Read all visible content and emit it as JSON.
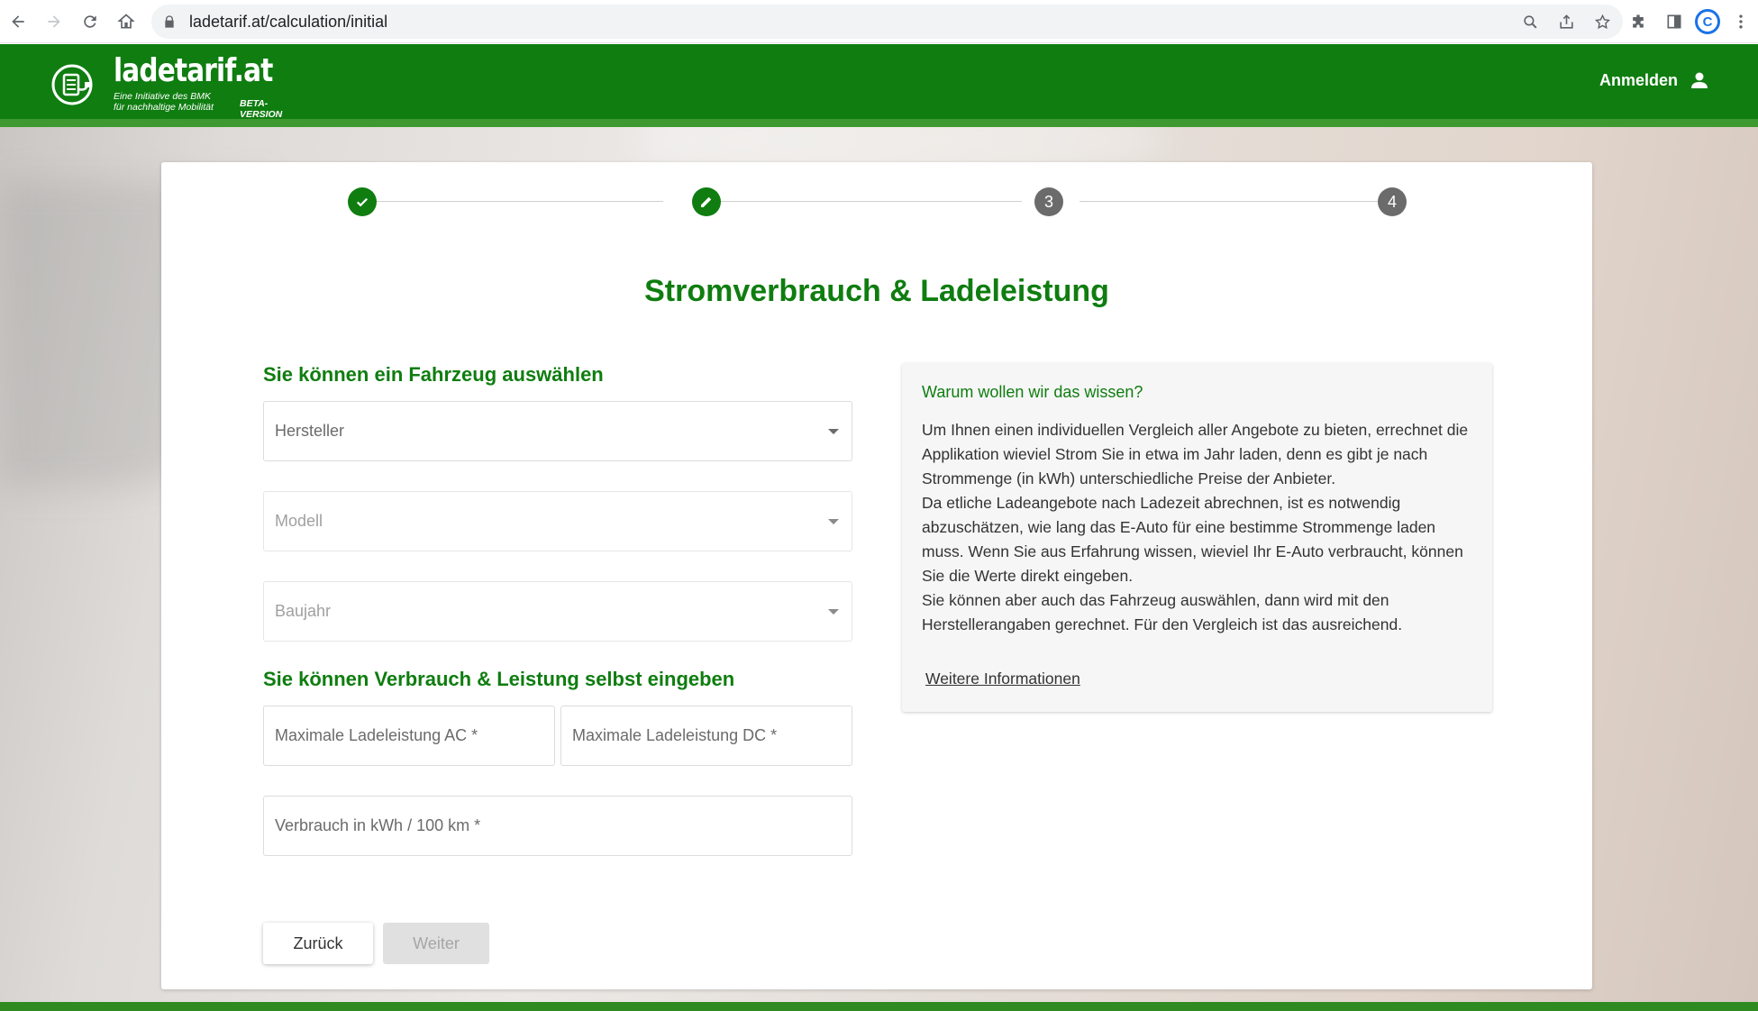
{
  "browser": {
    "url": "ladetarif.at/calculation/initial",
    "profile_initial": "C"
  },
  "header": {
    "logo_title": "ladetarif.at",
    "logo_sub_line1": "Eine Initiative des BMK",
    "logo_sub_line2": "für nachhaltige Mobilität",
    "beta_line1": "BETA-",
    "beta_line2": "VERSION",
    "login_label": "Anmelden"
  },
  "stepper": {
    "steps": [
      {
        "state": "done",
        "icon": "check-icon"
      },
      {
        "state": "active",
        "icon": "pencil-icon"
      },
      {
        "state": "todo",
        "label": "3"
      },
      {
        "state": "todo",
        "label": "4"
      }
    ]
  },
  "main": {
    "title": "Stromverbrauch & Ladeleistung",
    "vehicle_section_title": "Sie können ein Fahrzeug auswählen",
    "manufacturer_placeholder": "Hersteller",
    "model_placeholder": "Modell",
    "year_placeholder": "Baujahr",
    "manual_section_title": "Sie können Verbrauch & Leistung selbst eingeben",
    "ac_placeholder": "Maximale Ladeleistung AC *",
    "dc_placeholder": "Maximale Ladeleistung DC *",
    "consumption_placeholder": "Verbrauch in kWh / 100 km *",
    "back_label": "Zurück",
    "next_label": "Weiter"
  },
  "info": {
    "title": "Warum wollen wir das wissen?",
    "paragraph1": "Um Ihnen einen individuellen Vergleich aller Angebote zu bieten, errechnet die Applikation wieviel Strom Sie in etwa im Jahr laden, denn es gibt je nach Strommenge (in kWh) unterschiedliche Preise der Anbieter.",
    "paragraph2": "Da etliche Ladeangebote nach Ladezeit abrechnen, ist es notwendig abzuschätzen, wie lang das E-Auto für eine bestimme Strommenge laden muss. Wenn Sie aus Erfahrung wissen, wieviel Ihr E-Auto verbraucht, können Sie die Werte direkt eingeben.",
    "paragraph3": "Sie können aber auch das Fahrzeug auswählen, dann wird mit den Herstellerangaben gerechnet. Für den Vergleich ist das ausreichend.",
    "link_label": "Weitere Informationen"
  },
  "colors": {
    "brand_green": "#0f7d10",
    "step_todo": "#6b6b6b"
  }
}
